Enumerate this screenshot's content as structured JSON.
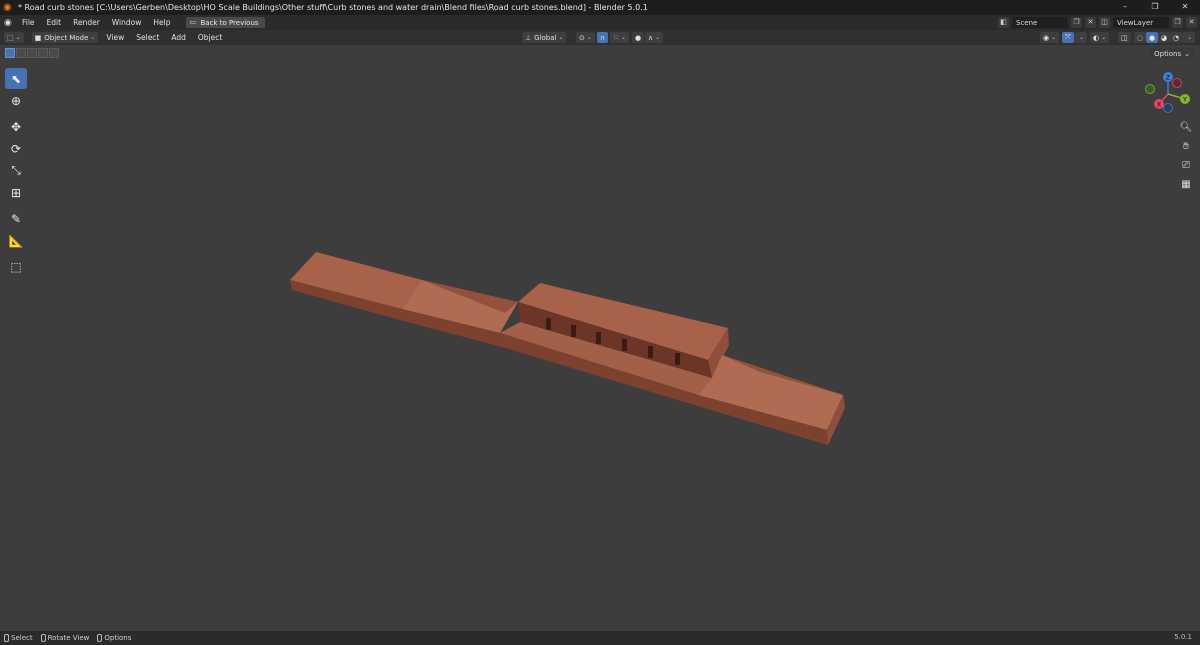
{
  "window": {
    "title": "* Road curb stones [C:\\Users\\Gerben\\Desktop\\HO Scale Buildings\\Other stuff\\Curb stones and water drain\\Blend files\\Road curb stones.blend] - Blender 5.0.1",
    "controls": [
      "–",
      "❐",
      "✕"
    ]
  },
  "topbar": {
    "menus": [
      "File",
      "Edit",
      "Render",
      "Window",
      "Help"
    ],
    "back_label": "Back to Previous",
    "scene_label": "Scene",
    "viewlayer_label": "ViewLayer"
  },
  "header": {
    "mode_label": "Object Mode",
    "menus": [
      "View",
      "Select",
      "Add",
      "Object"
    ],
    "orientation_label": "Global",
    "options_label": "Options"
  },
  "gizmo": {
    "x_label": "X",
    "y_label": "Y",
    "z_label": "Z",
    "x_color": "#e8435f",
    "y_color": "#7db82c",
    "z_color": "#3b7fd6"
  },
  "statusbar": {
    "items": [
      "Select",
      "Rotate View",
      "Options"
    ],
    "version": "5.0.1"
  },
  "colors": {
    "accent": "#4772b3",
    "model_top": "#a8624a",
    "model_side": "#8a4a36",
    "viewport_bg": "#3d3d3d"
  }
}
